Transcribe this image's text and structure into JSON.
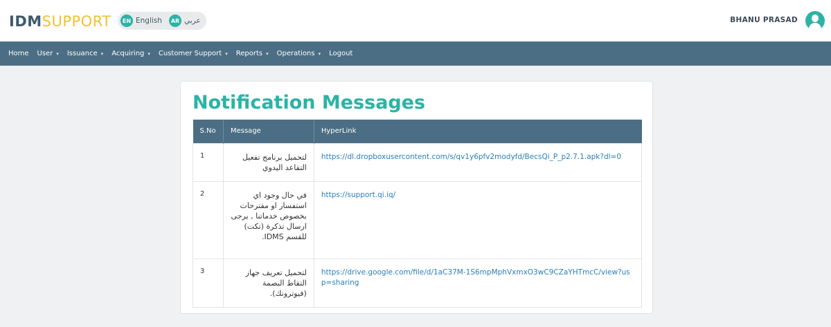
{
  "app": {
    "logo_bold": "IDM",
    "logo_light": "SUPPORT",
    "lang_en_badge": "EN",
    "lang_en_label": "English",
    "lang_ar_badge": "AR",
    "lang_ar_label": "عربي",
    "user_name": "BHANU PRASAD",
    "avatar_icon": "user-avatar-icon"
  },
  "nav": {
    "items": [
      {
        "label": "Home",
        "dropdown": false
      },
      {
        "label": "User",
        "dropdown": true
      },
      {
        "label": "Issuance",
        "dropdown": true
      },
      {
        "label": "Acquiring",
        "dropdown": true
      },
      {
        "label": "Customer Support",
        "dropdown": true
      },
      {
        "label": "Reports",
        "dropdown": true
      },
      {
        "label": "Operations",
        "dropdown": true
      },
      {
        "label": "Logout",
        "dropdown": false
      }
    ],
    "caret": "▾"
  },
  "page": {
    "title": "Notification Messages",
    "columns": [
      "S.No",
      "Message",
      "HyperLink"
    ],
    "rows": [
      {
        "sno": "1",
        "message": "لتحميل برنامج تفعيل التقاعد اليدوي",
        "link": "https://dl.dropboxusercontent.com/s/qv1y6pfv2modyfd/BecsQi_P_p2.7.1.apk?dl=0"
      },
      {
        "sno": "2",
        "message": "في حال وجود اي استفسار او مقترحات بخصوص خدماتنا , يرجى ارسال تذكرة (تكت) للقسم IDMS.",
        "link": "https://support.qi.iq/"
      },
      {
        "sno": "3",
        "message": "لتحميل تعريف جهاز التقاط البصمة (فيوترونك).",
        "link": "https://drive.google.com/file/d/1aC37M-1S6mpMphVxmxO3wC9CZaYHTmcC/view?usp=sharing"
      }
    ]
  },
  "colors": {
    "accent": "#2bb3a6",
    "nav_bg": "#4b6e84",
    "logo_yellow": "#f2c230",
    "link": "#2a7fb8"
  }
}
